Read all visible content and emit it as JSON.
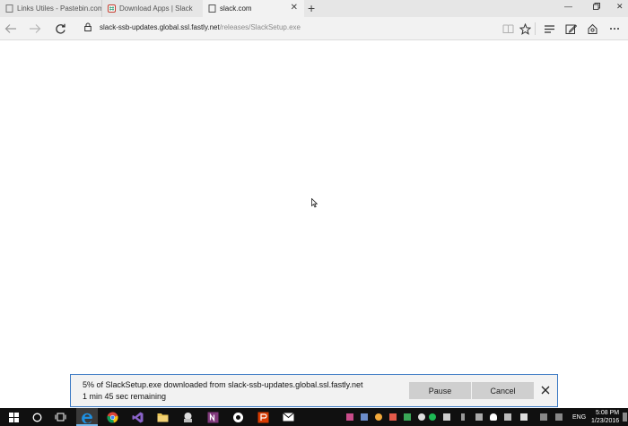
{
  "tabs": [
    {
      "label": "Links Utiles - Pastebin.com",
      "active": false
    },
    {
      "label": "Download Apps | Slack",
      "active": false
    },
    {
      "label": "slack.com",
      "active": true
    }
  ],
  "address": {
    "host": "slack-ssb-updates.global.ssl.fastly.net",
    "path": "/releases/SlackSetup.exe"
  },
  "download": {
    "status": "5% of SlackSetup.exe downloaded from slack-ssb-updates.global.ssl.fastly.net",
    "remaining": "1 min 45 sec remaining",
    "pause_label": "Pause",
    "cancel_label": "Cancel",
    "progress_percent": 5
  },
  "taskbar": {
    "language": "ENG",
    "time": "5:08 PM",
    "date": "1/23/2016",
    "pinned_icons": [
      "edge-icon",
      "chrome-icon",
      "visual-studio-icon",
      "file-explorer-icon",
      "app-icon",
      "onenote-icon",
      "app-icon",
      "office-icon",
      "mail-icon"
    ]
  },
  "colors": {
    "accent": "#3c7ac4",
    "taskbar": "#101010",
    "edge_blue": "#1e8fe0"
  }
}
